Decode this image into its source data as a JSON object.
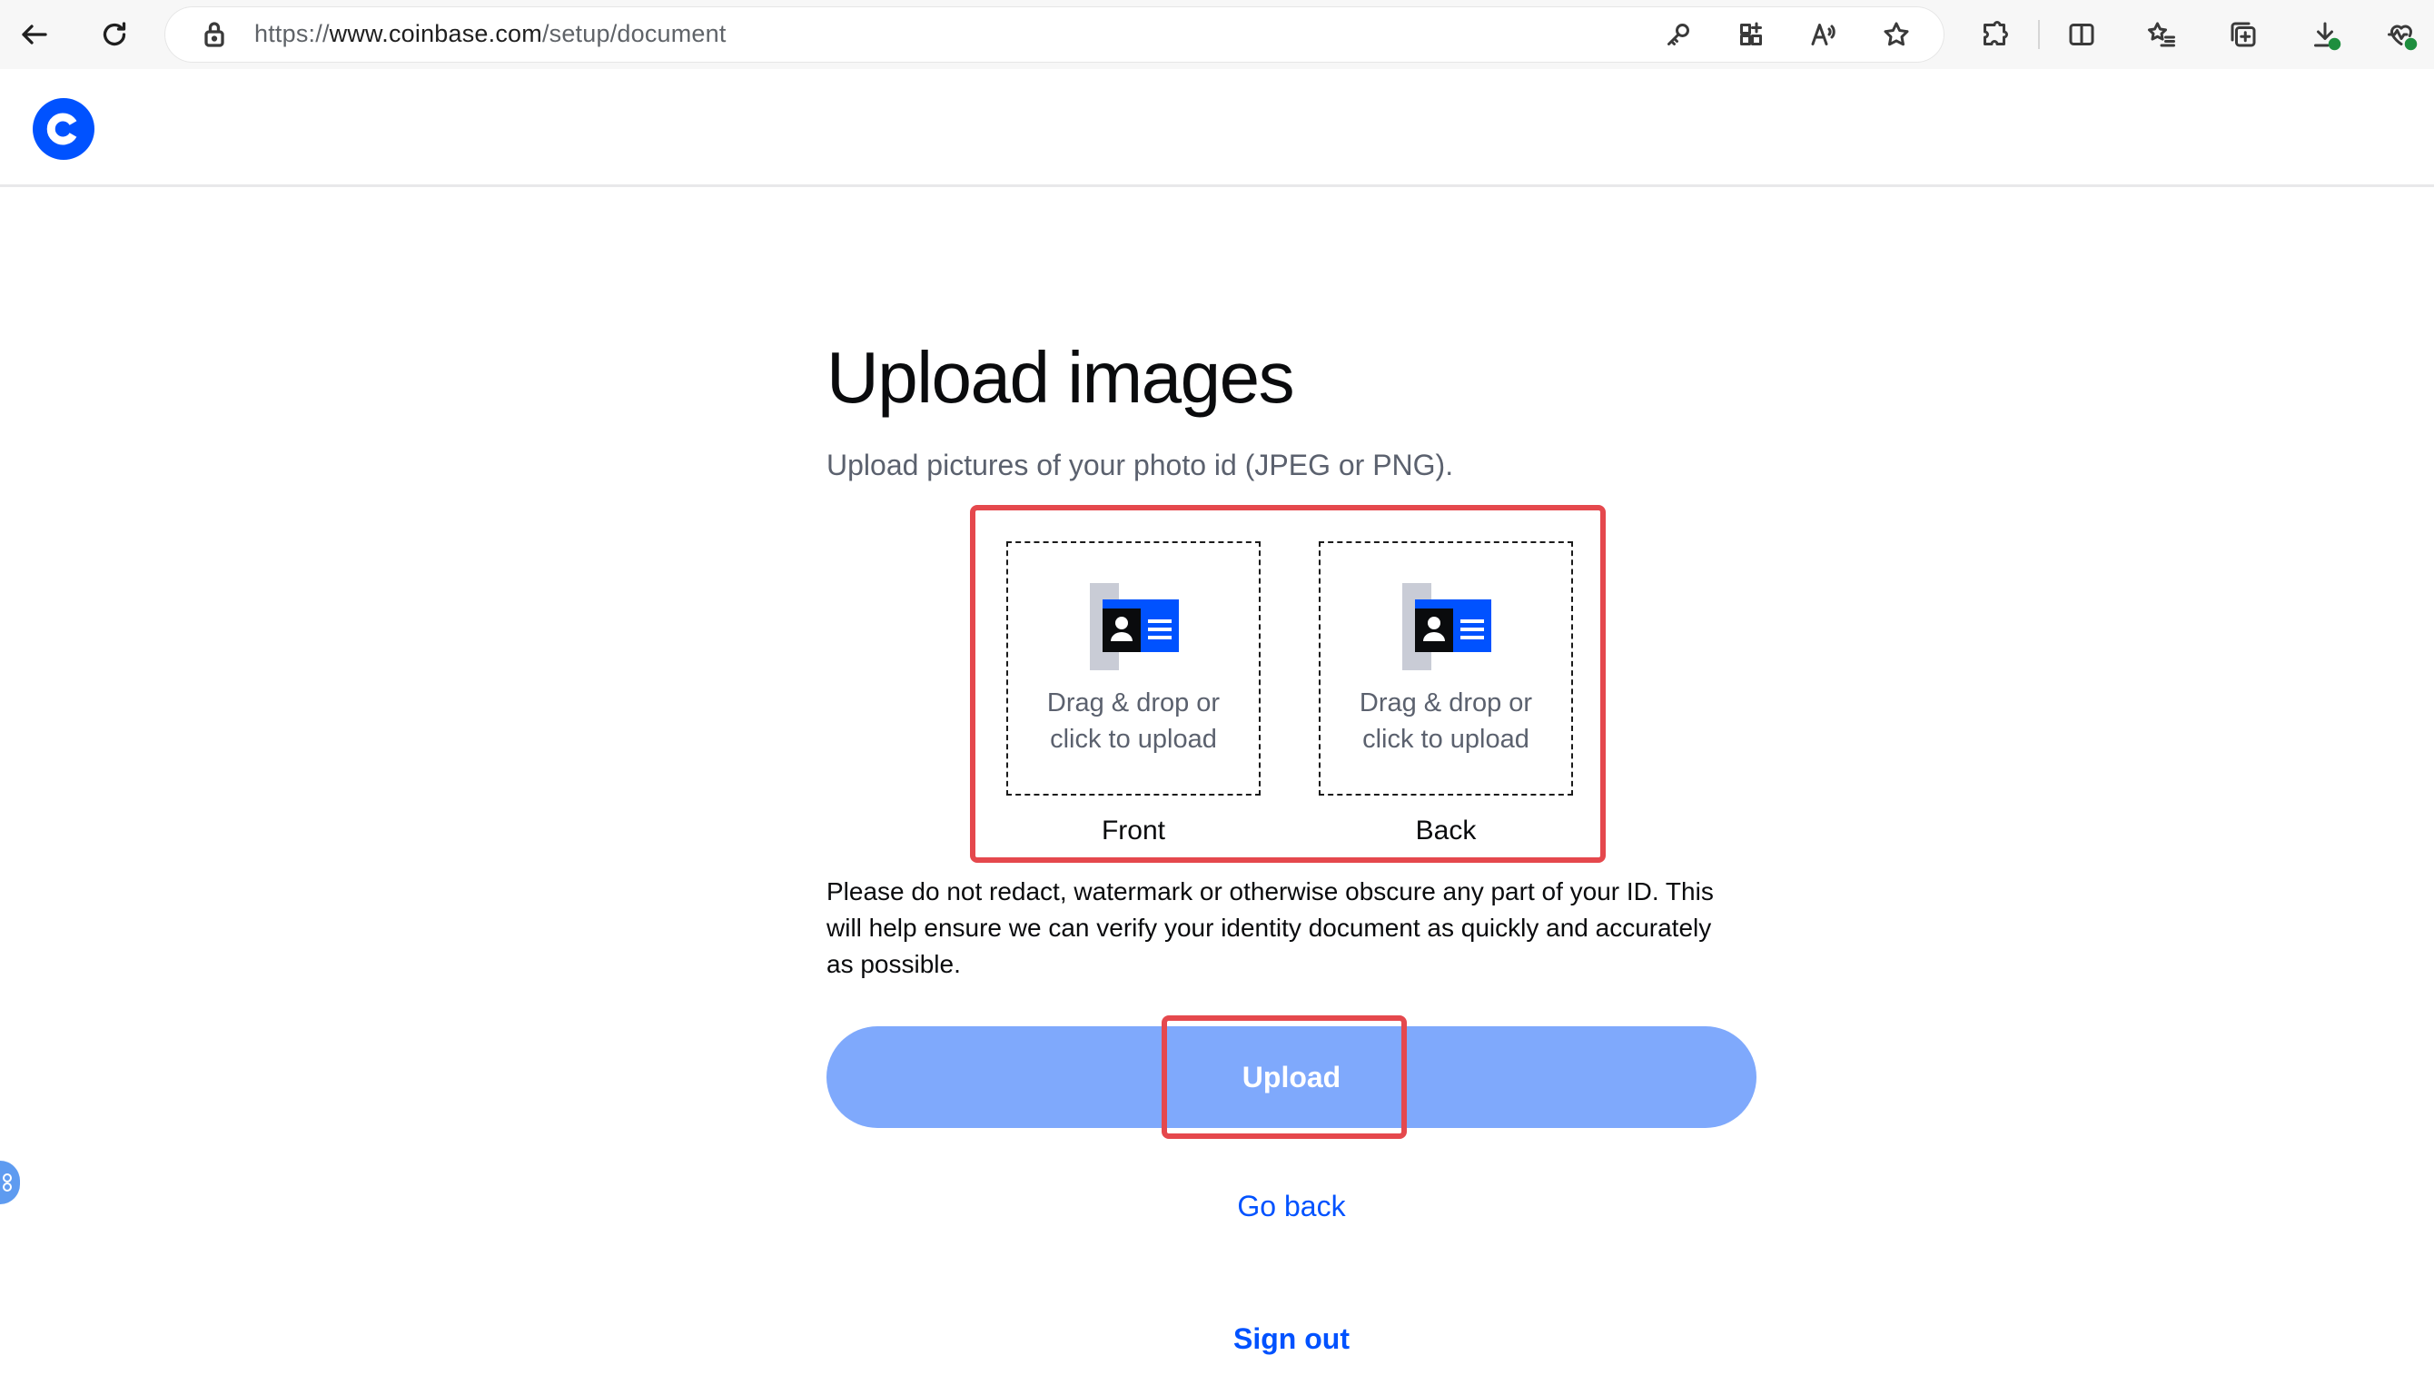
{
  "browser": {
    "url_prefix": "https://",
    "url_host": "www.coinbase.com",
    "url_path": "/setup/document",
    "icons": [
      "back-icon",
      "refresh-icon",
      "lock-icon",
      "key-icon",
      "apps-icon",
      "read-aloud-icon",
      "favorite-star-icon",
      "extensions-icon",
      "split-screen-icon",
      "favorites-list-icon",
      "collections-icon",
      "downloads-icon",
      "health-icon"
    ]
  },
  "app": {
    "logo": "coinbase-logo",
    "brand_color": "#0052ff"
  },
  "page": {
    "title": "Upload images",
    "subtitle": "Upload pictures of your photo id (JPEG or PNG).",
    "upload": {
      "front": {
        "line1": "Drag & drop or",
        "line2": "click to upload",
        "label": "Front"
      },
      "back": {
        "line1": "Drag & drop or",
        "line2": "click to upload",
        "label": "Back"
      }
    },
    "notice": "Please do not redact, watermark or otherwise obscure any part of your ID. This will help ensure we can verify your identity document as quickly and accurately as possible.",
    "upload_button": "Upload",
    "go_back": "Go back",
    "sign_out": "Sign out"
  },
  "colors": {
    "highlight": "#e5484d",
    "button_disabled": "#7fa9fc",
    "link": "#0052ff",
    "muted_text": "#5b616e"
  }
}
